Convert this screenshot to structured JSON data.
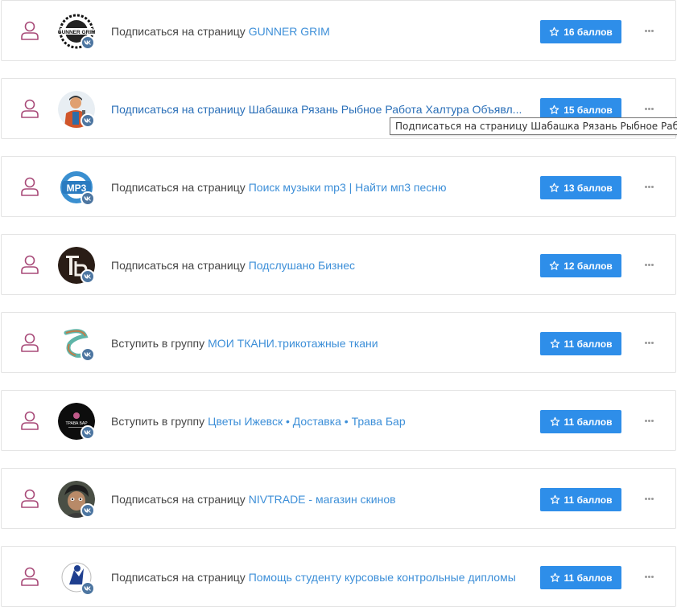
{
  "colors": {
    "accent": "#2e8ee9",
    "link": "#3d8fd8",
    "user_icon": "#9c3c6b",
    "vk_badge": "#4d76a1"
  },
  "tasks": [
    {
      "action": "Подписаться на страницу",
      "target": "GUNNER GRIM",
      "points": "16 баллов",
      "avatar": "gunner-grim-logo"
    },
    {
      "action": "Подписаться на страницу",
      "target": "Шабашка Рязань Рыбное Работа Халтура Объявл...",
      "points": "15 баллов",
      "avatar": "worker-illustration"
    },
    {
      "action": "Подписаться на страницу",
      "target": "Поиск музыки mp3 | Найти мп3 песню",
      "points": "13 баллов",
      "avatar": "mp3-logo"
    },
    {
      "action": "Подписаться на страницу",
      "target": "Подслушано Бизнес",
      "points": "12 баллов",
      "avatar": "business-logo"
    },
    {
      "action": "Вступить в группу",
      "target": "МОИ ТКАНИ.трикотажные ткани",
      "points": "11 баллов",
      "avatar": "fabric-logo"
    },
    {
      "action": "Вступить в группу",
      "target": "Цветы Ижевск • Доставка • Трава Бар",
      "points": "11 баллов",
      "avatar": "flowers-logo"
    },
    {
      "action": "Подписаться на страницу",
      "target": "NIVTRADE - магазин скинов",
      "points": "11 баллов",
      "avatar": "nivtrade-avatar"
    },
    {
      "action": "Подписаться на страницу",
      "target": "Помощь студенту курсовые контрольные дипломы",
      "points": "11 баллов",
      "avatar": "student-help-logo"
    }
  ],
  "tooltip": "Подписаться на страницу Шабашка Рязань Рыбное Работа Халтура Объявления"
}
